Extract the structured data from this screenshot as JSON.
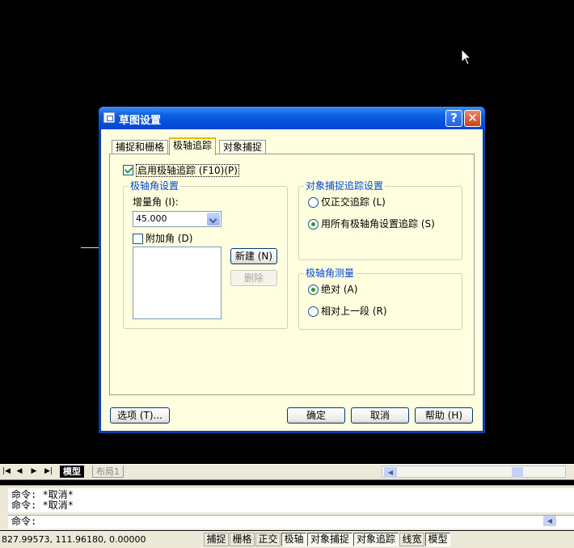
{
  "dialog": {
    "title": "草图设置",
    "help_glyph": "?",
    "close_glyph": "✕",
    "tabs": [
      {
        "label": "捕捉和栅格"
      },
      {
        "label": "极轴追踪"
      },
      {
        "label": "对象捕捉"
      }
    ],
    "enable_polar_label": "启用极轴追踪 (F10)(P)",
    "polar_angle_group": {
      "title": "极轴角设置",
      "increment_label": "增量角 (I):",
      "increment_value": "45.000",
      "additional_label": "附加角 (D)",
      "new_button": "新建 (N)",
      "delete_button": "删除"
    },
    "object_snap_group": {
      "title": "对象捕捉追踪设置",
      "option_orthogonal": "仅正交追踪 (L)",
      "option_all_polar": "用所有极轴角设置追踪 (S)"
    },
    "polar_measure_group": {
      "title": "极轴角测量",
      "option_absolute": "绝对 (A)",
      "option_relative": "相对上一段 (R)"
    },
    "buttons": {
      "options": "选项 (T)...",
      "ok": "确定",
      "cancel": "取消",
      "help": "帮助 (H)"
    }
  },
  "layout_tabs": {
    "nav": [
      "|◀",
      "◀",
      "▶",
      "▶|"
    ],
    "model": "模型",
    "layout1": "布局1"
  },
  "command": {
    "history": [
      "命令: *取消*",
      "命令: *取消*"
    ],
    "prompt": "命令:"
  },
  "status": {
    "coords": "827.99573, 111.96180, 0.00000",
    "toggles": [
      {
        "label": "捕捉"
      },
      {
        "label": "栅格"
      },
      {
        "label": "正交"
      },
      {
        "label": "极轴"
      },
      {
        "label": "对象捕捉"
      },
      {
        "label": "对象追踪"
      },
      {
        "label": "线宽"
      },
      {
        "label": "模型"
      }
    ]
  }
}
